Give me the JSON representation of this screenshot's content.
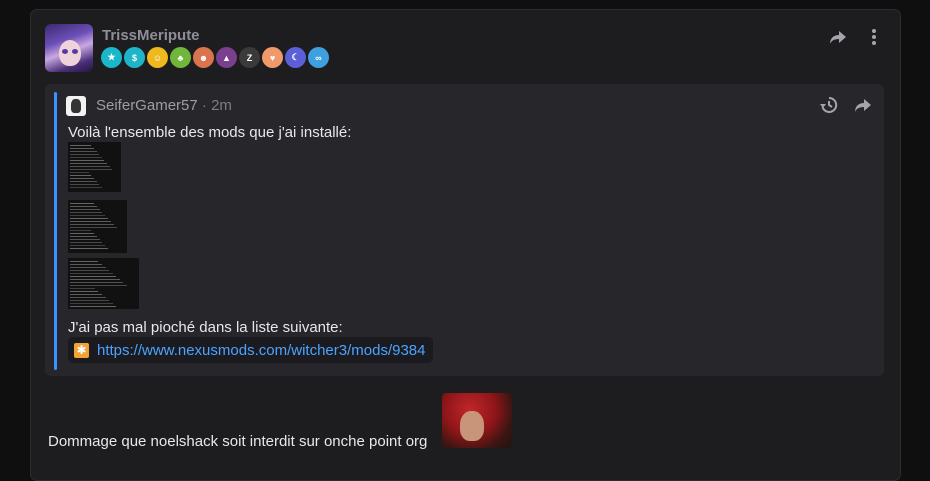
{
  "post": {
    "author": "TrissMeripute",
    "badges": [
      {
        "icon": "star-badge-icon",
        "glyph": "★",
        "color": "#19b7c9"
      },
      {
        "icon": "dollar-badge-icon",
        "glyph": "$",
        "color": "#1fb5c8"
      },
      {
        "icon": "smiley-badge-icon",
        "glyph": "☺",
        "color": "#f0b81f"
      },
      {
        "icon": "beer-badge-icon",
        "glyph": "♣",
        "color": "#6fb63a"
      },
      {
        "icon": "face-badge-icon",
        "glyph": "☻",
        "color": "#d9744c"
      },
      {
        "icon": "eagle-badge-icon",
        "glyph": "▲",
        "color": "#7b3f8f"
      },
      {
        "icon": "zero-tout-badge-icon",
        "glyph": "Z",
        "color": "#3a3a3a"
      },
      {
        "icon": "girl-badge-icon",
        "glyph": "♥",
        "color": "#f09a6c"
      },
      {
        "icon": "moon-badge-icon",
        "glyph": "☾",
        "color": "#5b5fd8"
      },
      {
        "icon": "goggles-badge-icon",
        "glyph": "∞",
        "color": "#3fa0e0"
      }
    ],
    "quote": {
      "author": "SeiferGamer57",
      "separator": " · ",
      "time": "2m",
      "line1": "Voilà l'ensemble des mods que j'ai installé:",
      "line2": "J'ai pas mal pioché dans la liste suivante:",
      "link": "https://www.nexusmods.com/witcher3/mods/9384"
    },
    "body": "Dommage que noelshack soit interdit sur onche point org"
  },
  "colors": {
    "accent": "#3a93ff",
    "link": "#4ba3ff"
  }
}
